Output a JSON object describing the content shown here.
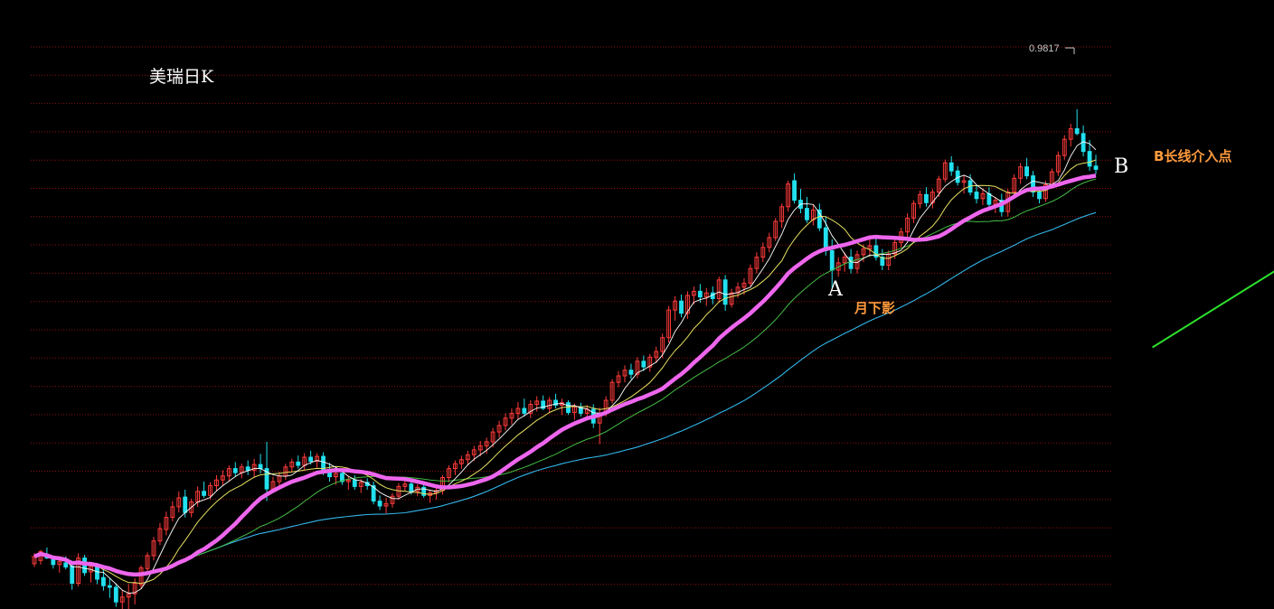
{
  "chart_data": {
    "type": "candlestick",
    "title": "美瑞日K",
    "peak_label": "0.9817",
    "ylim": [
      0.3,
      1.0
    ],
    "grid": "horizontal-dotted",
    "colors": {
      "background": "#000000",
      "grid": "#8a1010",
      "up": "#ff3b3b",
      "down": "#22e0ee",
      "ma_thick": "#ee66ee",
      "ma_short": "#ffffff",
      "ma_mid": "#e8e060",
      "ma_medium": "#44bb44",
      "ma_long": "#33b5e8",
      "trendline": "#2de02d",
      "annotation": "#ff9a3c"
    },
    "trendline": {
      "from": [
        178,
        0.595
      ],
      "to": [
        233,
        0.86
      ]
    },
    "marker_b": [
      225,
      0.768
    ],
    "annotations": {
      "a_label": "A",
      "a_note": "月下影",
      "b_label": "B",
      "b_note": "B长线介入点"
    },
    "ohlc": [
      [
        0.329,
        0.342,
        0.325,
        0.338
      ],
      [
        0.333,
        0.346,
        0.328,
        0.344
      ],
      [
        0.34,
        0.349,
        0.335,
        0.336
      ],
      [
        0.334,
        0.339,
        0.323,
        0.328
      ],
      [
        0.328,
        0.336,
        0.318,
        0.332
      ],
      [
        0.33,
        0.338,
        0.322,
        0.325
      ],
      [
        0.326,
        0.333,
        0.297,
        0.305
      ],
      [
        0.305,
        0.342,
        0.301,
        0.336
      ],
      [
        0.336,
        0.34,
        0.314,
        0.318
      ],
      [
        0.319,
        0.331,
        0.306,
        0.326
      ],
      [
        0.325,
        0.33,
        0.304,
        0.31
      ],
      [
        0.312,
        0.322,
        0.296,
        0.302
      ],
      [
        0.302,
        0.311,
        0.287,
        0.3
      ],
      [
        0.3,
        0.305,
        0.276,
        0.282
      ],
      [
        0.282,
        0.296,
        0.271,
        0.288
      ],
      [
        0.288,
        0.304,
        0.263,
        0.292
      ],
      [
        0.292,
        0.311,
        0.279,
        0.305
      ],
      [
        0.303,
        0.327,
        0.298,
        0.324
      ],
      [
        0.323,
        0.343,
        0.318,
        0.339
      ],
      [
        0.339,
        0.362,
        0.333,
        0.357
      ],
      [
        0.357,
        0.379,
        0.352,
        0.372
      ],
      [
        0.371,
        0.393,
        0.364,
        0.386
      ],
      [
        0.386,
        0.406,
        0.381,
        0.399
      ],
      [
        0.399,
        0.418,
        0.392,
        0.41
      ],
      [
        0.411,
        0.42,
        0.386,
        0.392
      ],
      [
        0.392,
        0.409,
        0.386,
        0.405
      ],
      [
        0.405,
        0.424,
        0.399,
        0.418
      ],
      [
        0.418,
        0.43,
        0.41,
        0.413
      ],
      [
        0.413,
        0.429,
        0.408,
        0.425
      ],
      [
        0.425,
        0.438,
        0.418,
        0.432
      ],
      [
        0.432,
        0.444,
        0.425,
        0.437
      ],
      [
        0.437,
        0.45,
        0.43,
        0.446
      ],
      [
        0.446,
        0.454,
        0.436,
        0.441
      ],
      [
        0.441,
        0.452,
        0.434,
        0.448
      ],
      [
        0.448,
        0.456,
        0.438,
        0.444
      ],
      [
        0.444,
        0.458,
        0.436,
        0.451
      ],
      [
        0.451,
        0.464,
        0.44,
        0.446
      ],
      [
        0.446,
        0.479,
        0.406,
        0.421
      ],
      [
        0.421,
        0.436,
        0.416,
        0.43
      ],
      [
        0.43,
        0.442,
        0.424,
        0.437
      ],
      [
        0.437,
        0.452,
        0.432,
        0.448
      ],
      [
        0.448,
        0.458,
        0.442,
        0.454
      ],
      [
        0.454,
        0.462,
        0.446,
        0.45
      ],
      [
        0.45,
        0.465,
        0.444,
        0.46
      ],
      [
        0.46,
        0.468,
        0.451,
        0.455
      ],
      [
        0.455,
        0.465,
        0.447,
        0.461
      ],
      [
        0.461,
        0.466,
        0.438,
        0.445
      ],
      [
        0.445,
        0.453,
        0.43,
        0.436
      ],
      [
        0.436,
        0.444,
        0.426,
        0.44
      ],
      [
        0.44,
        0.446,
        0.426,
        0.43
      ],
      [
        0.43,
        0.437,
        0.42,
        0.432
      ],
      [
        0.432,
        0.438,
        0.42,
        0.424
      ],
      [
        0.424,
        0.433,
        0.416,
        0.429
      ],
      [
        0.429,
        0.434,
        0.42,
        0.425
      ],
      [
        0.425,
        0.43,
        0.402,
        0.406
      ],
      [
        0.406,
        0.413,
        0.395,
        0.4
      ],
      [
        0.4,
        0.41,
        0.391,
        0.403
      ],
      [
        0.403,
        0.416,
        0.398,
        0.412
      ],
      [
        0.412,
        0.428,
        0.408,
        0.424
      ],
      [
        0.424,
        0.434,
        0.418,
        0.427
      ],
      [
        0.427,
        0.431,
        0.414,
        0.418
      ],
      [
        0.418,
        0.427,
        0.412,
        0.423
      ],
      [
        0.423,
        0.428,
        0.41,
        0.413
      ],
      [
        0.413,
        0.42,
        0.404,
        0.416
      ],
      [
        0.416,
        0.424,
        0.408,
        0.419
      ],
      [
        0.419,
        0.438,
        0.414,
        0.435
      ],
      [
        0.435,
        0.45,
        0.429,
        0.446
      ],
      [
        0.446,
        0.456,
        0.438,
        0.452
      ],
      [
        0.452,
        0.462,
        0.446,
        0.457
      ],
      [
        0.457,
        0.468,
        0.45,
        0.463
      ],
      [
        0.463,
        0.474,
        0.455,
        0.469
      ],
      [
        0.469,
        0.48,
        0.461,
        0.474
      ],
      [
        0.474,
        0.484,
        0.464,
        0.479
      ],
      [
        0.479,
        0.496,
        0.472,
        0.491
      ],
      [
        0.491,
        0.505,
        0.484,
        0.499
      ],
      [
        0.499,
        0.514,
        0.493,
        0.508
      ],
      [
        0.508,
        0.52,
        0.5,
        0.514
      ],
      [
        0.514,
        0.528,
        0.506,
        0.52
      ],
      [
        0.52,
        0.532,
        0.51,
        0.514
      ],
      [
        0.514,
        0.53,
        0.508,
        0.525
      ],
      [
        0.525,
        0.535,
        0.516,
        0.529
      ],
      [
        0.529,
        0.536,
        0.518,
        0.52
      ],
      [
        0.52,
        0.534,
        0.514,
        0.53
      ],
      [
        0.53,
        0.538,
        0.52,
        0.524
      ],
      [
        0.524,
        0.532,
        0.512,
        0.527
      ],
      [
        0.527,
        0.53,
        0.512,
        0.515
      ],
      [
        0.515,
        0.526,
        0.506,
        0.522
      ],
      [
        0.522,
        0.527,
        0.51,
        0.514
      ],
      [
        0.514,
        0.524,
        0.508,
        0.519
      ],
      [
        0.519,
        0.525,
        0.496,
        0.502
      ],
      [
        0.502,
        0.521,
        0.476,
        0.514
      ],
      [
        0.514,
        0.535,
        0.51,
        0.53
      ],
      [
        0.53,
        0.556,
        0.526,
        0.552
      ],
      [
        0.552,
        0.566,
        0.546,
        0.56
      ],
      [
        0.56,
        0.573,
        0.552,
        0.567
      ],
      [
        0.567,
        0.575,
        0.556,
        0.562
      ],
      [
        0.562,
        0.583,
        0.557,
        0.578
      ],
      [
        0.578,
        0.585,
        0.566,
        0.571
      ],
      [
        0.571,
        0.587,
        0.565,
        0.583
      ],
      [
        0.583,
        0.596,
        0.576,
        0.59
      ],
      [
        0.59,
        0.612,
        0.582,
        0.607
      ],
      [
        0.607,
        0.646,
        0.601,
        0.641
      ],
      [
        0.641,
        0.658,
        0.628,
        0.652
      ],
      [
        0.652,
        0.66,
        0.632,
        0.637
      ],
      [
        0.637,
        0.664,
        0.63,
        0.659
      ],
      [
        0.659,
        0.67,
        0.648,
        0.664
      ],
      [
        0.664,
        0.673,
        0.65,
        0.657
      ],
      [
        0.657,
        0.668,
        0.646,
        0.662
      ],
      [
        0.662,
        0.67,
        0.648,
        0.655
      ],
      [
        0.655,
        0.682,
        0.65,
        0.678
      ],
      [
        0.678,
        0.684,
        0.64,
        0.648
      ],
      [
        0.648,
        0.667,
        0.644,
        0.662
      ],
      [
        0.662,
        0.675,
        0.656,
        0.669
      ],
      [
        0.669,
        0.68,
        0.66,
        0.674
      ],
      [
        0.674,
        0.697,
        0.67,
        0.692
      ],
      [
        0.692,
        0.712,
        0.686,
        0.706
      ],
      [
        0.706,
        0.724,
        0.7,
        0.718
      ],
      [
        0.718,
        0.736,
        0.712,
        0.73
      ],
      [
        0.73,
        0.754,
        0.726,
        0.75
      ],
      [
        0.75,
        0.772,
        0.742,
        0.768
      ],
      [
        0.768,
        0.8,
        0.762,
        0.796
      ],
      [
        0.8,
        0.809,
        0.772,
        0.776
      ],
      [
        0.776,
        0.79,
        0.76,
        0.766
      ],
      [
        0.766,
        0.78,
        0.748,
        0.752
      ],
      [
        0.752,
        0.77,
        0.745,
        0.764
      ],
      [
        0.764,
        0.772,
        0.738,
        0.742
      ],
      [
        0.742,
        0.756,
        0.708,
        0.714
      ],
      [
        0.714,
        0.728,
        0.668,
        0.69
      ],
      [
        0.69,
        0.706,
        0.682,
        0.699
      ],
      [
        0.699,
        0.712,
        0.688,
        0.706
      ],
      [
        0.706,
        0.716,
        0.686,
        0.692
      ],
      [
        0.692,
        0.714,
        0.686,
        0.709
      ],
      [
        0.709,
        0.722,
        0.7,
        0.716
      ],
      [
        0.716,
        0.728,
        0.706,
        0.72
      ],
      [
        0.72,
        0.73,
        0.702,
        0.706
      ],
      [
        0.706,
        0.716,
        0.69,
        0.696
      ],
      [
        0.696,
        0.714,
        0.69,
        0.71
      ],
      [
        0.71,
        0.728,
        0.704,
        0.724
      ],
      [
        0.724,
        0.742,
        0.718,
        0.737
      ],
      [
        0.737,
        0.76,
        0.73,
        0.754
      ],
      [
        0.754,
        0.776,
        0.748,
        0.772
      ],
      [
        0.772,
        0.788,
        0.766,
        0.783
      ],
      [
        0.783,
        0.792,
        0.768,
        0.773
      ],
      [
        0.773,
        0.79,
        0.766,
        0.786
      ],
      [
        0.786,
        0.806,
        0.78,
        0.802
      ],
      [
        0.802,
        0.826,
        0.798,
        0.822
      ],
      [
        0.822,
        0.83,
        0.806,
        0.812
      ],
      [
        0.812,
        0.818,
        0.794,
        0.798
      ],
      [
        0.798,
        0.806,
        0.784,
        0.8
      ],
      [
        0.8,
        0.808,
        0.782,
        0.786
      ],
      [
        0.786,
        0.794,
        0.772,
        0.778
      ],
      [
        0.778,
        0.79,
        0.77,
        0.784
      ],
      [
        0.784,
        0.792,
        0.766,
        0.771
      ],
      [
        0.771,
        0.78,
        0.76,
        0.776
      ],
      [
        0.776,
        0.784,
        0.756,
        0.762
      ],
      [
        0.762,
        0.79,
        0.756,
        0.786
      ],
      [
        0.786,
        0.808,
        0.78,
        0.803
      ],
      [
        0.803,
        0.822,
        0.796,
        0.817
      ],
      [
        0.817,
        0.828,
        0.802,
        0.806
      ],
      [
        0.806,
        0.812,
        0.78,
        0.786
      ],
      [
        0.786,
        0.792,
        0.772,
        0.778
      ],
      [
        0.778,
        0.8,
        0.774,
        0.795
      ],
      [
        0.795,
        0.815,
        0.79,
        0.811
      ],
      [
        0.811,
        0.836,
        0.806,
        0.831
      ],
      [
        0.831,
        0.856,
        0.826,
        0.851
      ],
      [
        0.851,
        0.87,
        0.842,
        0.864
      ],
      [
        0.864,
        0.888,
        0.856,
        0.858
      ],
      [
        0.858,
        0.868,
        0.83,
        0.836
      ],
      [
        0.836,
        0.85,
        0.812,
        0.818
      ],
      [
        0.818,
        0.832,
        0.808,
        0.814
      ]
    ]
  }
}
